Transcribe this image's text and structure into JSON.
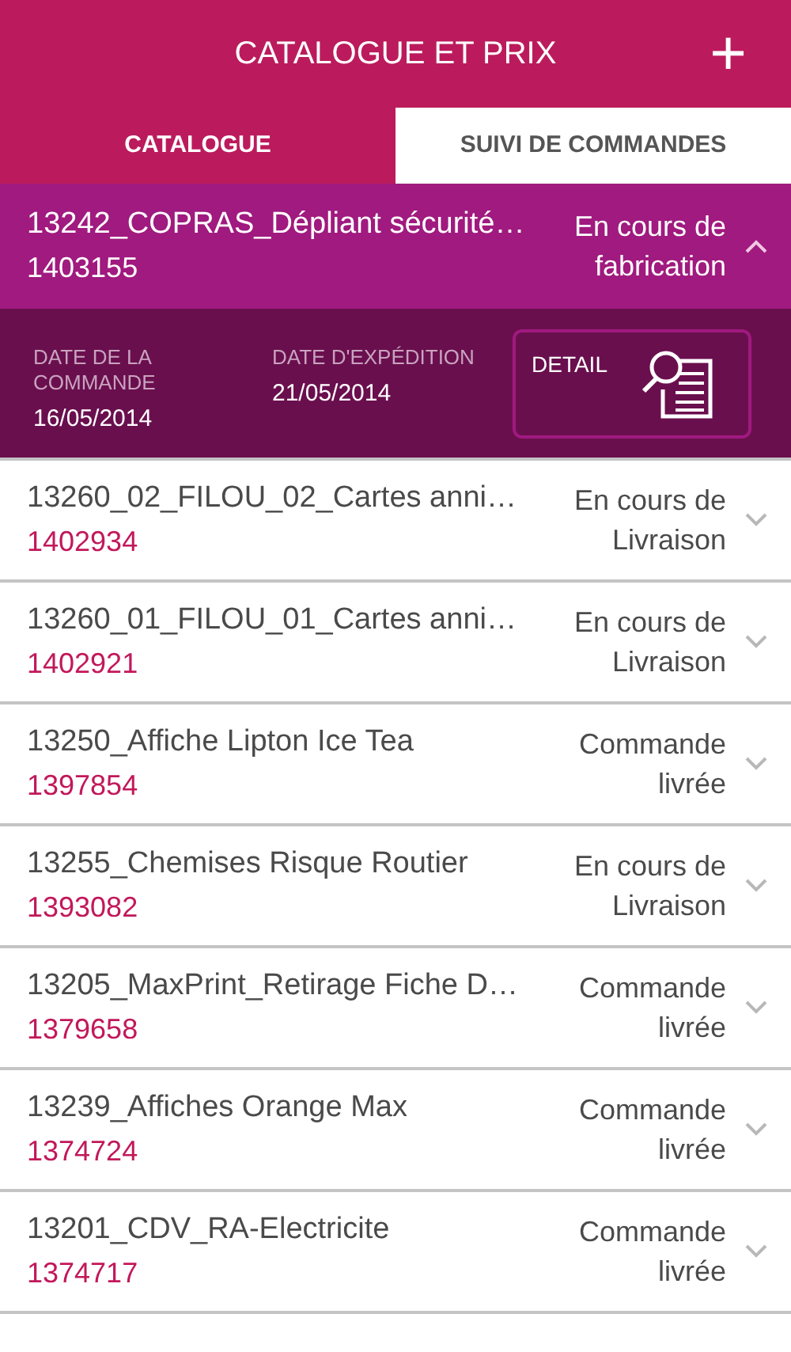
{
  "header": {
    "title": "CATALOGUE ET PRIX",
    "add_icon_label": "+"
  },
  "tabs": [
    {
      "label": "CATALOGUE",
      "selected": false
    },
    {
      "label": "SUIVI DE COMMANDES",
      "selected": true
    }
  ],
  "orders": [
    {
      "name": "13242_COPRAS_Dépliant sécurité…",
      "number": "1403155",
      "status": "En cours de fabrication",
      "expanded": true,
      "detail": {
        "order_date_label": "DATE DE LA COMMANDE",
        "order_date": "16/05/2014",
        "ship_date_label": "DATE D'EXPÉDITION",
        "ship_date": "21/05/2014",
        "button": "DETAIL"
      }
    },
    {
      "name": "13260_02_FILOU_02_Cartes anni…",
      "number": "1402934",
      "status": "En cours de Livraison",
      "expanded": false
    },
    {
      "name": "13260_01_FILOU_01_Cartes anni…",
      "number": "1402921",
      "status": "En cours de Livraison",
      "expanded": false
    },
    {
      "name": "13250_Affiche Lipton Ice Tea",
      "number": "1397854",
      "status": "Commande livrée",
      "expanded": false
    },
    {
      "name": "13255_Chemises Risque Routier",
      "number": "1393082",
      "status": "En cours de Livraison",
      "expanded": false
    },
    {
      "name": "13205_MaxPrint_Retirage Fiche D…",
      "number": "1379658",
      "status": "Commande livrée",
      "expanded": false
    },
    {
      "name": "13239_Affiches Orange Max",
      "number": "1374724",
      "status": "Commande livrée",
      "expanded": false
    },
    {
      "name": "13201_CDV_RA-Electricite",
      "number": "1374717",
      "status": "Commande livrée",
      "expanded": false
    }
  ]
}
